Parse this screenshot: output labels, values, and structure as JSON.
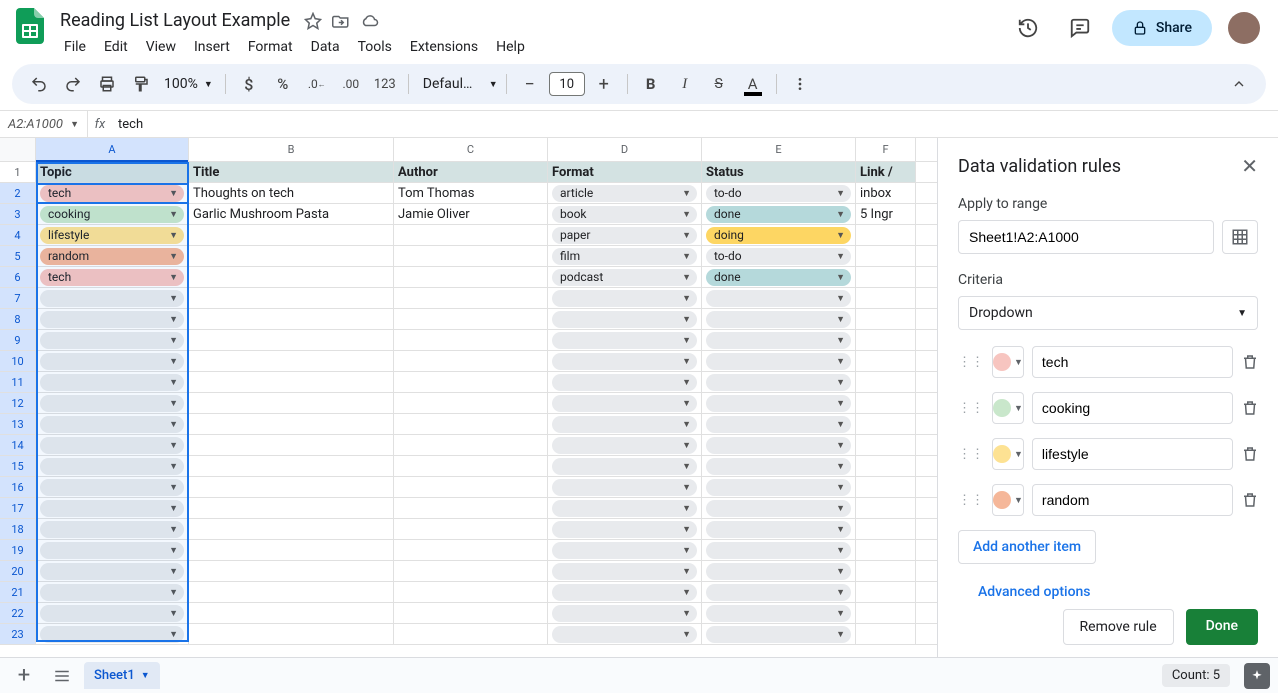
{
  "doc": {
    "title": "Reading List Layout Example"
  },
  "menus": [
    "File",
    "Edit",
    "View",
    "Insert",
    "Format",
    "Data",
    "Tools",
    "Extensions",
    "Help"
  ],
  "share_label": "Share",
  "toolbar": {
    "zoom": "100%",
    "num123": "123",
    "font": "Defaul…",
    "fontsize": "10"
  },
  "namebox": "A2:A1000",
  "formula": "tech",
  "columns": [
    "A",
    "B",
    "C",
    "D",
    "E",
    "F"
  ],
  "col_header_label_f": "Link /",
  "headers": [
    "Topic",
    "Title",
    "Author",
    "Format",
    "Status"
  ],
  "rows": [
    {
      "topic": "tech",
      "topic_cls": "chip-tech",
      "title": "Thoughts on tech",
      "author": "Tom Thomas",
      "format": "article",
      "status": "to-do",
      "status_cls": "chip-todo",
      "link": "inbox"
    },
    {
      "topic": "cooking",
      "topic_cls": "chip-cooking",
      "title": "Garlic Mushroom Pasta",
      "author": "Jamie Oliver",
      "format": "book",
      "status": "done",
      "status_cls": "chip-done",
      "link": "5 Ingr"
    },
    {
      "topic": "lifestyle",
      "topic_cls": "chip-lifestyle",
      "title": "",
      "author": "",
      "format": "paper",
      "status": "doing",
      "status_cls": "chip-doing",
      "link": ""
    },
    {
      "topic": "random",
      "topic_cls": "chip-random",
      "title": "",
      "author": "",
      "format": "film",
      "status": "to-do",
      "status_cls": "chip-todo",
      "link": ""
    },
    {
      "topic": "tech",
      "topic_cls": "chip-tech",
      "title": "",
      "author": "",
      "format": "podcast",
      "status": "done",
      "status_cls": "chip-done",
      "link": ""
    }
  ],
  "empty_rows": 17,
  "sidepanel": {
    "title": "Data validation rules",
    "apply_label": "Apply to range",
    "range": "Sheet1!A2:A1000",
    "criteria_label": "Criteria",
    "criteria_value": "Dropdown",
    "options": [
      {
        "label": "tech",
        "color": "#f7c5c0"
      },
      {
        "label": "cooking",
        "color": "#c9e7cb"
      },
      {
        "label": "lifestyle",
        "color": "#fde293"
      },
      {
        "label": "random",
        "color": "#f5b799"
      }
    ],
    "add_item": "Add another item",
    "advanced": "Advanced options",
    "remove": "Remove rule",
    "done": "Done"
  },
  "sheet_tab": "Sheet1",
  "count_label": "Count: 5"
}
